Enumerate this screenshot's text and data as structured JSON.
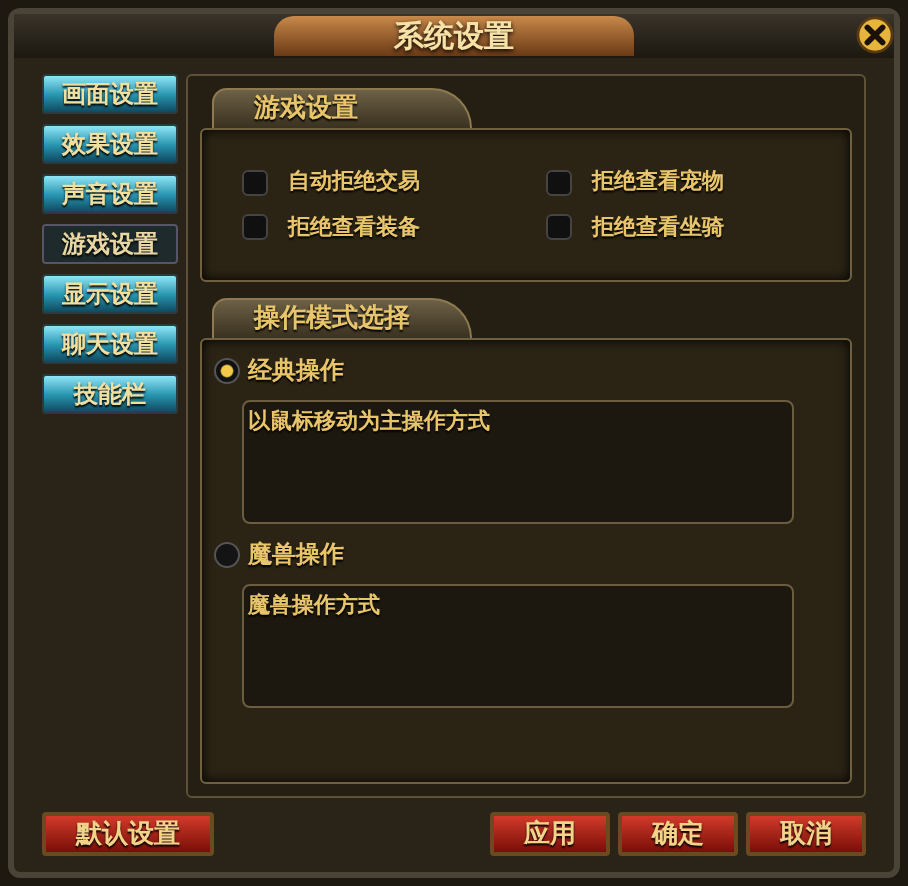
{
  "window": {
    "title": "系统设置"
  },
  "sidebar": {
    "items": [
      {
        "label": "画面设置",
        "selected": false
      },
      {
        "label": "效果设置",
        "selected": false
      },
      {
        "label": "声音设置",
        "selected": false
      },
      {
        "label": "游戏设置",
        "selected": true
      },
      {
        "label": "显示设置",
        "selected": false
      },
      {
        "label": "聊天设置",
        "selected": false
      },
      {
        "label": "技能栏",
        "selected": false
      }
    ]
  },
  "game_settings": {
    "title": "游戏设置",
    "options": [
      {
        "label": "自动拒绝交易",
        "checked": false
      },
      {
        "label": "拒绝查看宠物",
        "checked": false
      },
      {
        "label": "拒绝查看装备",
        "checked": false
      },
      {
        "label": "拒绝查看坐骑",
        "checked": false
      }
    ]
  },
  "control_mode": {
    "title": "操作模式选择",
    "modes": [
      {
        "label": "经典操作",
        "selected": true,
        "description": "以鼠标移动为主操作方式"
      },
      {
        "label": "魔兽操作",
        "selected": false,
        "description": "魔兽操作方式"
      }
    ]
  },
  "buttons": {
    "left": [
      "默认设置"
    ],
    "right": [
      "应用",
      "确定",
      "取消"
    ]
  }
}
